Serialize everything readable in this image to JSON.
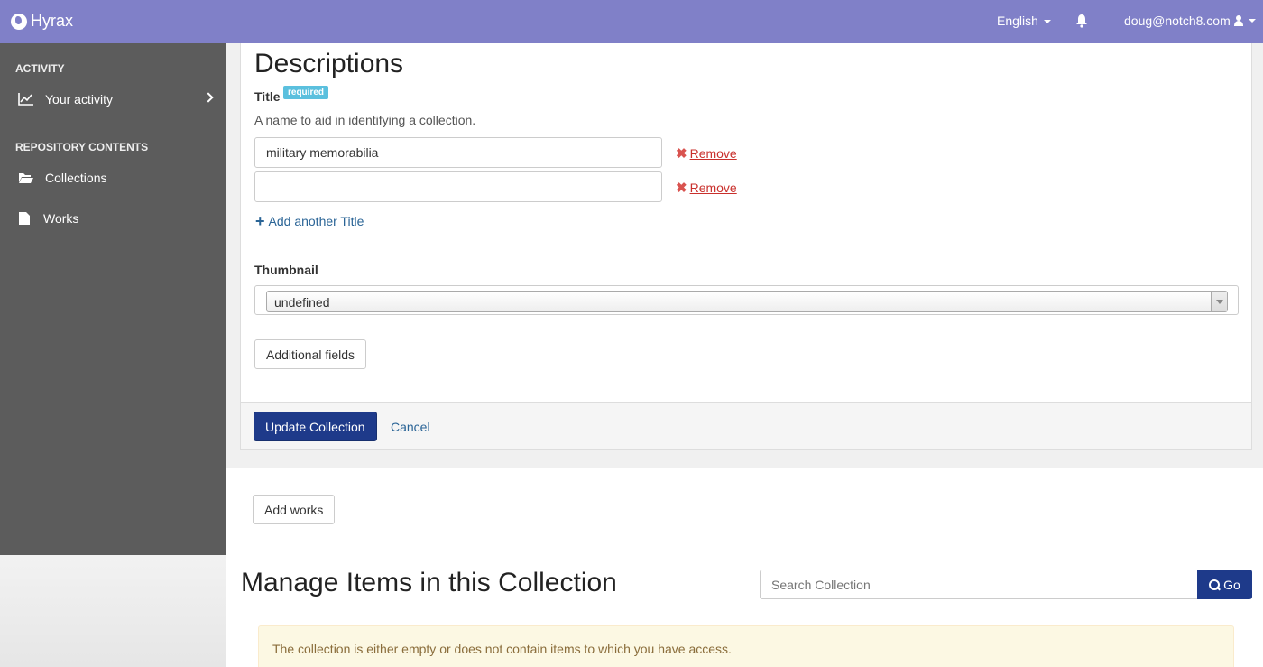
{
  "navbar": {
    "brand": "Hyrax",
    "language": "English",
    "user": "doug@notch8.com"
  },
  "sidebar": {
    "sections": [
      {
        "heading": "ACTIVITY",
        "items": [
          {
            "label": "Your activity",
            "icon": "line-chart-icon"
          }
        ]
      },
      {
        "heading": "REPOSITORY CONTENTS",
        "items": [
          {
            "label": "Collections",
            "icon": "folder-open-icon"
          },
          {
            "label": "Works",
            "icon": "file-icon"
          }
        ]
      }
    ]
  },
  "form": {
    "heading": "Descriptions",
    "title_label": "Title",
    "required_badge": "required",
    "title_help": "A name to aid in identifying a collection.",
    "title_values": [
      "military memorabilia",
      ""
    ],
    "remove_label": "Remove",
    "add_another": "Add another Title",
    "thumbnail_label": "Thumbnail",
    "thumbnail_value": "undefined",
    "additional_fields": "Additional fields",
    "update_button": "Update Collection",
    "cancel": "Cancel"
  },
  "items": {
    "add_works": "Add works",
    "heading": "Manage Items in this Collection",
    "search_placeholder": "Search Collection",
    "go_button": "Go",
    "empty_message": "The collection is either empty or does not contain items to which you have access."
  },
  "colors": {
    "navbar": "#8080c8",
    "sidebar": "#5c5c5c",
    "primary": "#1e3a8a",
    "remove": "#d9534f",
    "badge": "#5bc0de",
    "alert_bg": "#fcf8e3"
  }
}
